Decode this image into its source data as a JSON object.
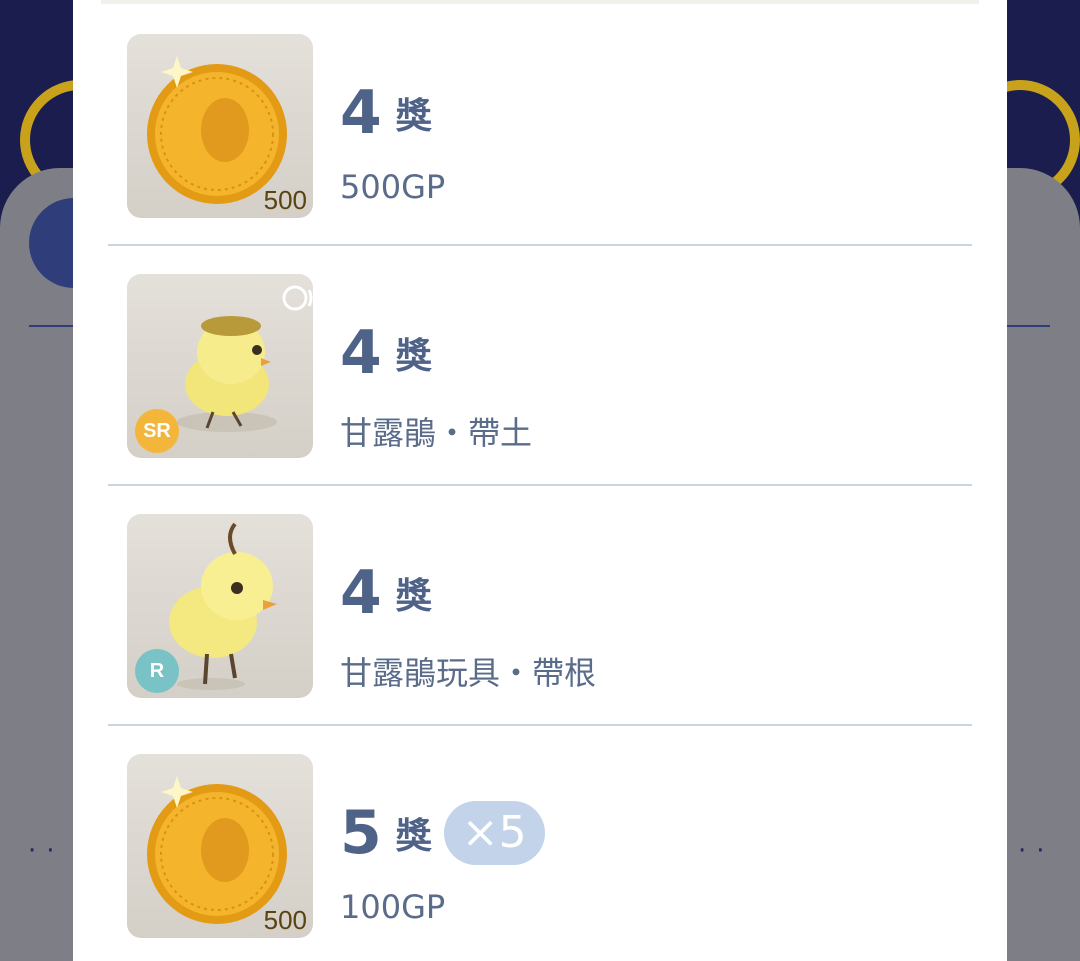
{
  "prizes": [
    {
      "rank_number": "4",
      "rank_word": "獎",
      "name": "500GP",
      "thumb": "gold-coin-icon",
      "thumb_value": "500"
    },
    {
      "rank_number": "4",
      "rank_word": "獎",
      "name": "甘露鵑・帶土",
      "thumb": "chick-icon",
      "rarity": "SR",
      "sound_icon": "chirp-face-icon"
    },
    {
      "rank_number": "4",
      "rank_word": "獎",
      "name": "甘露鵑玩具・帶根",
      "thumb": "toy-chick-icon",
      "rarity": "R"
    },
    {
      "rank_number": "5",
      "rank_word": "獎",
      "multiplier": "×5",
      "name": "100GP",
      "thumb": "gold-coin-icon",
      "thumb_value": "500"
    }
  ],
  "colors": {
    "rank_text": "#4f6388",
    "divider": "#c9d6df",
    "multiplier_bg": "#c2d3ea",
    "sr_badge": "#f3b63a",
    "r_badge": "#79c3c6",
    "coin": "#f0b62e"
  }
}
